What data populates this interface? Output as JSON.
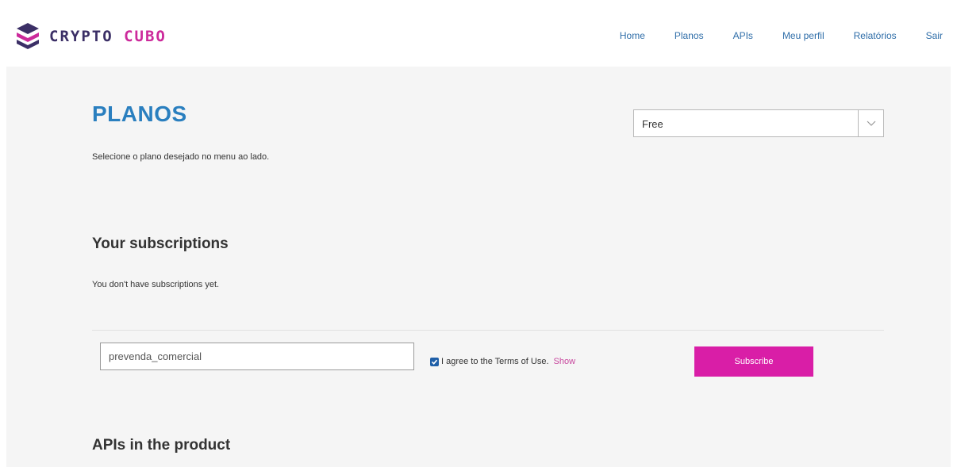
{
  "brand": {
    "word1": "CRYPTO",
    "word2": "CUBO",
    "colors": {
      "dark": "#3b2f66",
      "magenta": "#cc2a9b"
    }
  },
  "nav": {
    "items": [
      {
        "label": "Home"
      },
      {
        "label": "Planos"
      },
      {
        "label": "APIs"
      },
      {
        "label": "Meu perfil"
      },
      {
        "label": "Relatórios"
      },
      {
        "label": "Sair"
      }
    ]
  },
  "page": {
    "title": "PLANOS",
    "subtitle": "Selecione o plano desejado no menu ao lado."
  },
  "plan_select": {
    "selected": "Free",
    "icon": "chevron-down-icon"
  },
  "subscriptions": {
    "title": "Your subscriptions",
    "empty_text": "You don't have subscriptions yet."
  },
  "subscribe_form": {
    "name_value": "prevenda_comercial",
    "terms_checked": true,
    "terms_text": "I agree to the Terms of Use.",
    "terms_link": "Show",
    "button_label": "Subscribe",
    "button_color": "#d91ea7"
  },
  "apis": {
    "title": "APIs in the product"
  },
  "colors": {
    "accent": "#2a7fbf",
    "background": "#f5f5f5"
  }
}
